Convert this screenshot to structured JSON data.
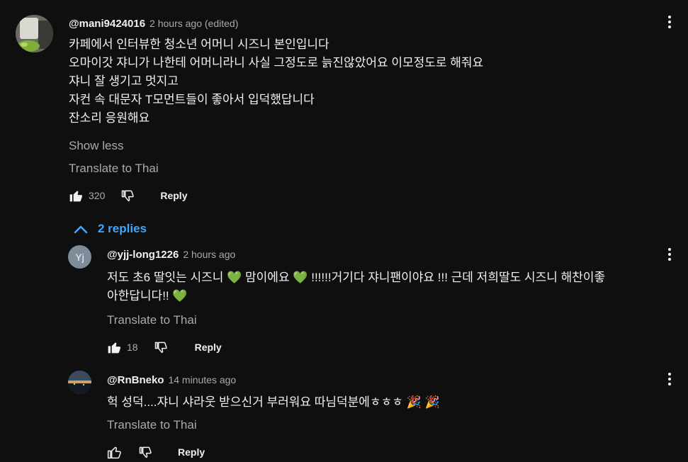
{
  "main_comment": {
    "author": "@mani9424016",
    "timestamp": "2 hours ago (edited)",
    "lines": [
      "카페에서  인터뷰한 청소년 어머니 시즈니 본인입니다",
      "오마이갓 쟈니가 나한테 어머니라니  사실 그정도로 늙진않았어요 이모정도로 해줘요",
      "쟈니 잘 생기고 멋지고",
      "자컨 속 대문자 T모먼트들이  좋아서 입덕했답니다",
      "잔소리 응원해요"
    ],
    "show_less": "Show less",
    "translate": "Translate to Thai",
    "likes": "320",
    "reply_label": "Reply"
  },
  "replies_toggle": "2 replies",
  "replies": [
    {
      "avatar_initials": "Yj",
      "author": "@yjj-long1226",
      "timestamp": "2 hours ago",
      "line1_a": "저도 초6 딸잇는 시즈니",
      "line1_b": "맘이에요",
      "line1_c": "!!!!!!거기다 쟈니팬이야요 !!!  근데 저희딸도 시즈니 해찬이좋",
      "line2_a": "아한답니다!!",
      "heart": "💚",
      "translate": "Translate to Thai",
      "likes": "18",
      "reply_label": "Reply"
    },
    {
      "author": "@RnBneko",
      "timestamp": "14 minutes ago",
      "line1": "헉 성덕....쟈니 샤라웃 받으신거 부러워요 따님덕분에ㅎㅎㅎ",
      "party": "🎉 🎉",
      "translate": "Translate to Thai",
      "reply_label": "Reply"
    }
  ]
}
